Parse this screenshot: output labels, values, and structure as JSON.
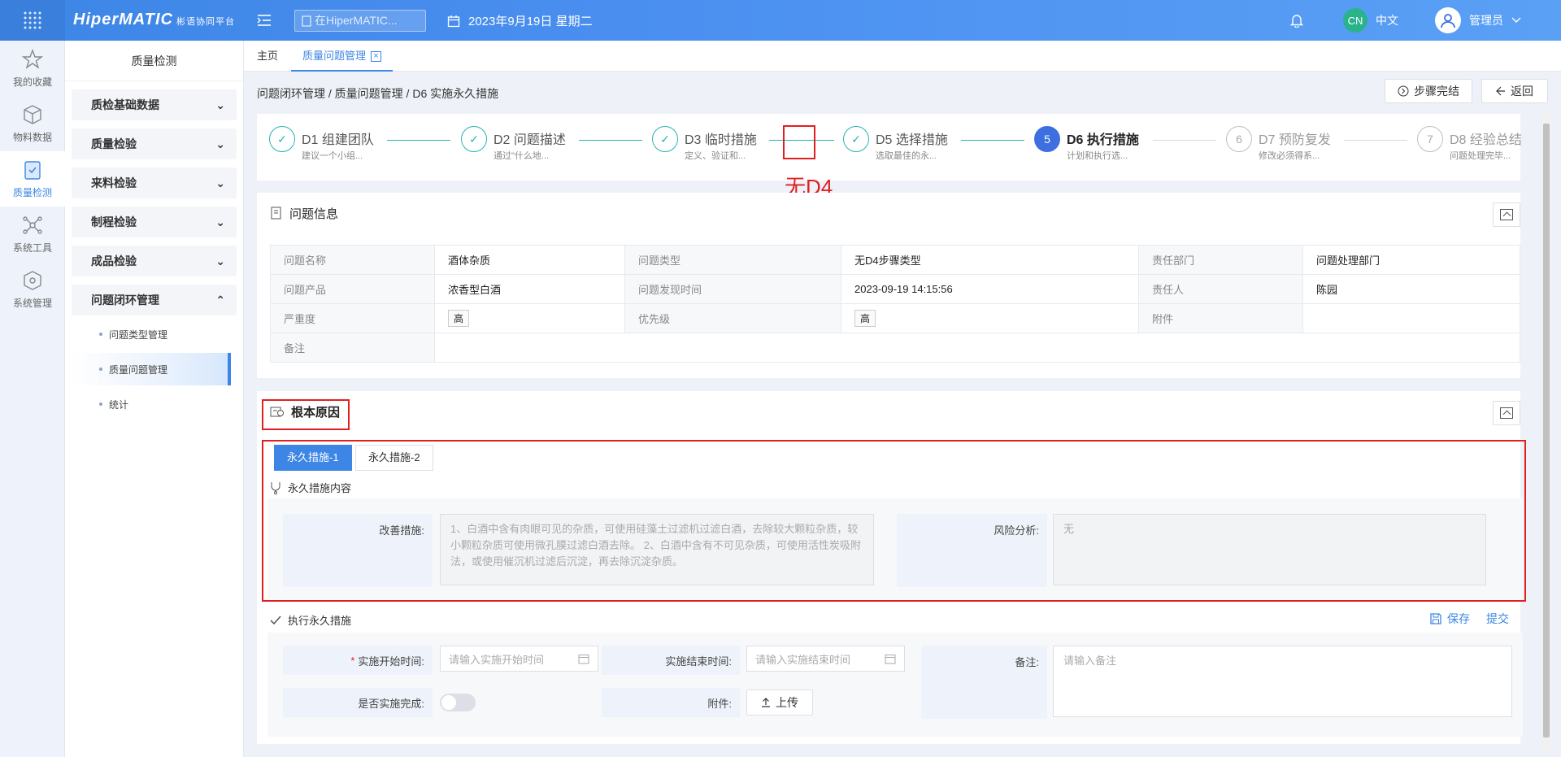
{
  "app": {
    "logo": "HiperMATIC",
    "logo_sub": "彬语协同平台"
  },
  "topbar": {
    "search_placeholder": "在HiperMATIC...",
    "date": "2023年9月19日 星期二",
    "lang_badge": "CN",
    "lang_label": "中文",
    "user_name": "管理员"
  },
  "rail": [
    {
      "label": "我的收藏",
      "icon": "star-icon"
    },
    {
      "label": "物料数据",
      "icon": "cube-icon"
    },
    {
      "label": "质量检测",
      "icon": "shield-icon"
    },
    {
      "label": "系统工具",
      "icon": "network-icon"
    },
    {
      "label": "系统管理",
      "icon": "box-icon"
    }
  ],
  "sidebar": {
    "title": "质量检测",
    "groups": [
      "质检基础数据",
      "质量检验",
      "来料检验",
      "制程检验",
      "成品检验",
      "问题闭环管理"
    ],
    "subitems": [
      "问题类型管理",
      "质量问题管理",
      "统计"
    ]
  },
  "tabs": {
    "home": "主页",
    "current": "质量问题管理",
    "close": "×"
  },
  "breadcrumb": "问题闭环管理 / 质量问题管理 / D6 实施永久措施",
  "actions": {
    "step_complete": "步骤完结",
    "back": "返回"
  },
  "steps": [
    {
      "title": "D1 组建团队",
      "desc": "建议一个小组...",
      "state": "done",
      "mark": "✓"
    },
    {
      "title": "D2 问题描述",
      "desc": "通过\"什么地...",
      "state": "done",
      "mark": "✓"
    },
    {
      "title": "D3 临时措施",
      "desc": "定义、验证和...",
      "state": "done",
      "mark": "✓"
    },
    {
      "title": "D5 选择措施",
      "desc": "选取最佳的永...",
      "state": "done",
      "mark": "✓"
    },
    {
      "title": "D6 执行措施",
      "desc": "计划和执行选...",
      "state": "active",
      "mark": "5"
    },
    {
      "title": "D7 预防复发",
      "desc": "修改必须得系...",
      "state": "todo",
      "mark": "6"
    },
    {
      "title": "D8 经验总结",
      "desc": "问题处理完毕...",
      "state": "todo",
      "mark": "7"
    }
  ],
  "annotation": "无D4",
  "problem_info": {
    "title": "问题信息",
    "rows": [
      [
        "问题名称",
        "酒体杂质",
        "问题类型",
        "无D4步骤类型",
        "责任部门",
        "问题处理部门"
      ],
      [
        "问题产品",
        "浓香型白酒",
        "问题发现时间",
        "2023-09-19 14:15:56",
        "责任人",
        "陈园"
      ],
      [
        "严重度",
        "高",
        "优先级",
        "高",
        "附件",
        ""
      ],
      [
        "备注",
        ""
      ]
    ]
  },
  "root_cause": {
    "title": "根本原因",
    "subtabs": [
      "永久措施-1",
      "永久措施-2"
    ],
    "content_label": "永久措施内容",
    "improve_label": "改善措施:",
    "improve_text": "1、白酒中含有肉眼可见的杂质，可使用硅藻土过滤机过滤白酒，去除较大颗粒杂质，较小颗粒杂质可使用微孔膜过滤白酒去除。 2、白酒中含有不可见杂质，可使用活性炭吸附法，或使用催沉机过滤后沉淀，再去除沉淀杂质。",
    "risk_label": "风险分析:",
    "risk_text": "无"
  },
  "execute": {
    "title": "执行永久措施",
    "save": "保存",
    "submit": "提交",
    "start_label": "实施开始时间:",
    "start_placeholder": "请输入实施开始时间",
    "end_label": "实施结束时间:",
    "end_placeholder": "请输入实施结束时间",
    "remark_label": "备注:",
    "remark_placeholder": "请输入备注",
    "done_label": "是否实施完成:",
    "attach_label": "附件:",
    "upload": "上传",
    "required_mark": "*"
  },
  "colors": {
    "primary": "#3d86e6",
    "success": "#28b3b3",
    "annotation": "#e02020"
  }
}
